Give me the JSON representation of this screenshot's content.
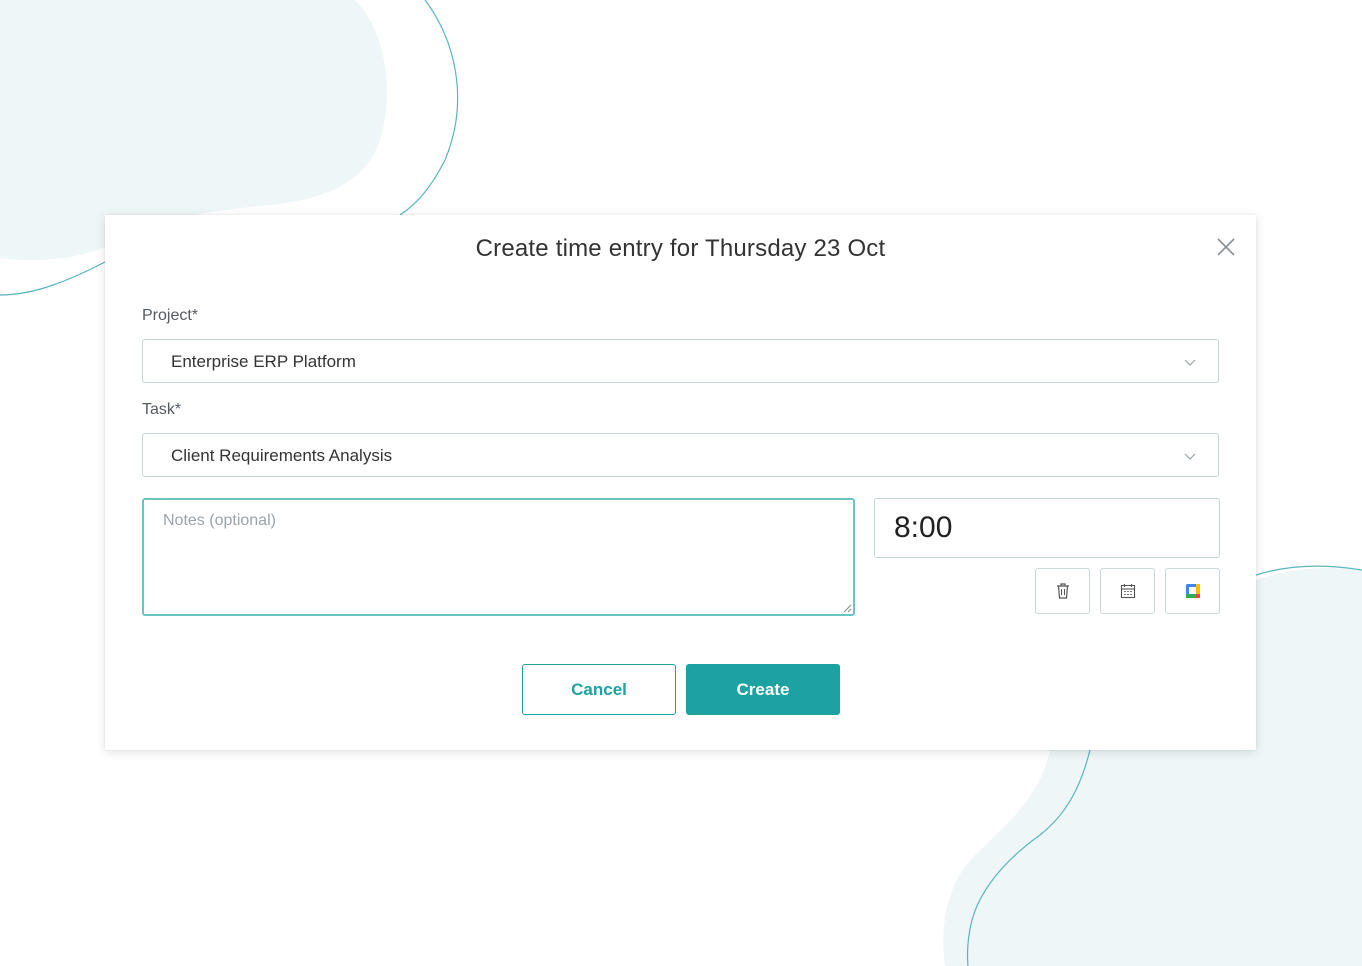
{
  "dialog": {
    "title": "Create time entry for Thursday 23 Oct"
  },
  "project": {
    "label": "Project*",
    "value": "Enterprise ERP Platform"
  },
  "task": {
    "label": "Task*",
    "value": "Client Requirements Analysis"
  },
  "notes": {
    "placeholder": "Notes (optional)",
    "value": ""
  },
  "duration": {
    "value": "8:00"
  },
  "actions": {
    "cancel_label": "Cancel",
    "create_label": "Create"
  },
  "icons": {
    "close": "close-icon",
    "chevron": "chevron-down-icon",
    "delete": "trash-icon",
    "calendar": "calendar-icon",
    "google_calendar": "google-calendar-icon"
  },
  "colors": {
    "accent": "#1ea1a1",
    "focus_border": "#6cc3c3",
    "background_blob": "#eef6f7",
    "blob_line": "#5ab5bd"
  }
}
